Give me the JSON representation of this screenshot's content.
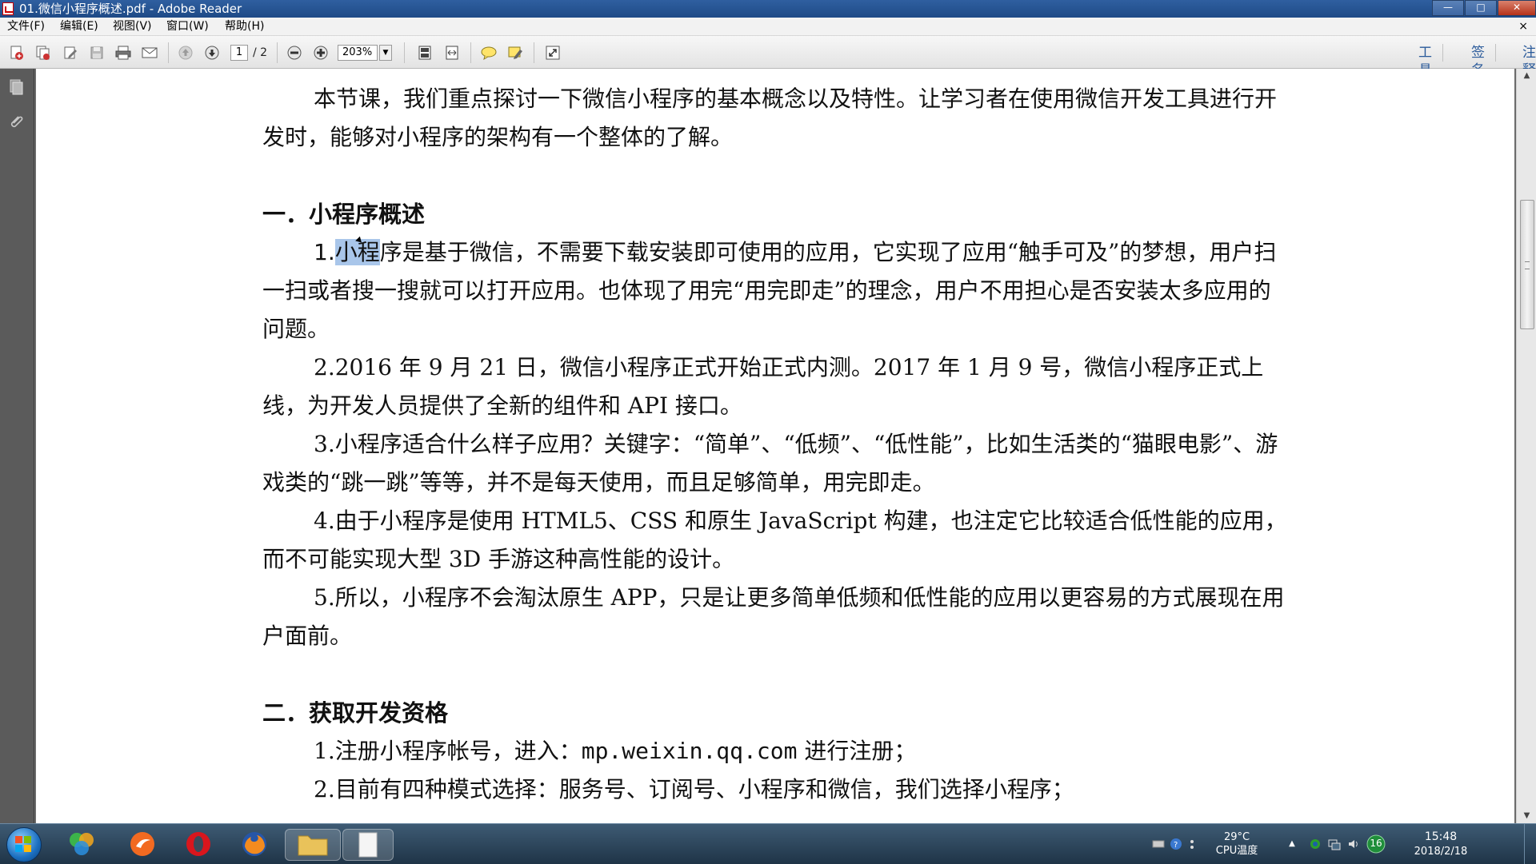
{
  "window": {
    "title": "01.微信小程序概述.pdf - Adobe Reader",
    "minimize": "—",
    "maximize": "□",
    "close": "✕"
  },
  "menu": {
    "items": [
      "文件(F)",
      "编辑(E)",
      "视图(V)",
      "窗口(W)",
      "帮助(H)"
    ],
    "doc_close": "×"
  },
  "toolbar": {
    "page_current": "1",
    "page_total": "/ 2",
    "zoom": "203%",
    "zoom_dropdown": "▼",
    "right_tools": [
      "工具",
      "签名",
      "注释"
    ]
  },
  "icons": {
    "toolbar": [
      "create-pdf-icon",
      "combine-pdf-icon",
      "edit-pdf-icon",
      "save-icon",
      "print-icon",
      "email-icon",
      "prev-page-icon",
      "next-page-icon",
      "zoom-out-icon",
      "zoom-in-icon",
      "fit-page-icon",
      "fit-width-icon",
      "comment-icon",
      "highlight-icon",
      "fullscreen-icon"
    ],
    "nav": [
      "pages-panel-icon",
      "attachments-icon"
    ]
  },
  "document": {
    "intro": "本节课，我们重点探讨一下微信小程序的基本概念以及特性。让学习者在使用微信开发工具进行开发时，能够对小程序的架构有一个整体的了解。",
    "section1_title": "一．小程序概述",
    "p1_prefix": "1.",
    "p1_highlight": "小程",
    "p1_rest": "序是基于微信，不需要下载安装即可使用的应用，它实现了应用“触手可及”的梦想，用户扫一扫或者搜一搜就可以打开应用。也体现了用完“用完即走”的理念，用户不用担心是否安装太多应用的问题。",
    "p2": "2.2016 年 9 月 21 日，微信小程序正式开始正式内测。2017 年 1 月 9 号，微信小程序正式上线，为开发人员提供了全新的组件和 API 接口。",
    "p3": "3.小程序适合什么样子应用？关键字：“简单”、“低频”、“低性能”，比如生活类的“猫眼电影”、游戏类的“跳一跳”等等，并不是每天使用，而且足够简单，用完即走。",
    "p4": "4.由于小程序是使用 HTML5、CSS 和原生 JavaScript 构建，也注定它比较适合低性能的应用，而不可能实现大型 3D 手游这种高性能的设计。",
    "p5": "5.所以，小程序不会淘汰原生 APP，只是让更多简单低频和低性能的应用以更容易的方式展现在用户面前。",
    "section2_title": "二．获取开发资格",
    "s2_p1_prefix": "1.注册小程序帐号，进入：",
    "s2_p1_url": "mp.weixin.qq.com",
    "s2_p1_suffix": " 进行注册；",
    "s2_p2": "2.目前有四种模式选择：服务号、订阅号、小程序和微信，我们选择小程序；"
  },
  "taskbar": {
    "temperature": "29°C",
    "temperature_label": "CPU温度",
    "badge": "16",
    "time": "15:48",
    "date": "2018/2/18",
    "tray_expand": "▲"
  },
  "colors": {
    "highlight": "#a9c6ea",
    "link_blue": "#2a5a9a",
    "taskbar": "#2c465d"
  }
}
